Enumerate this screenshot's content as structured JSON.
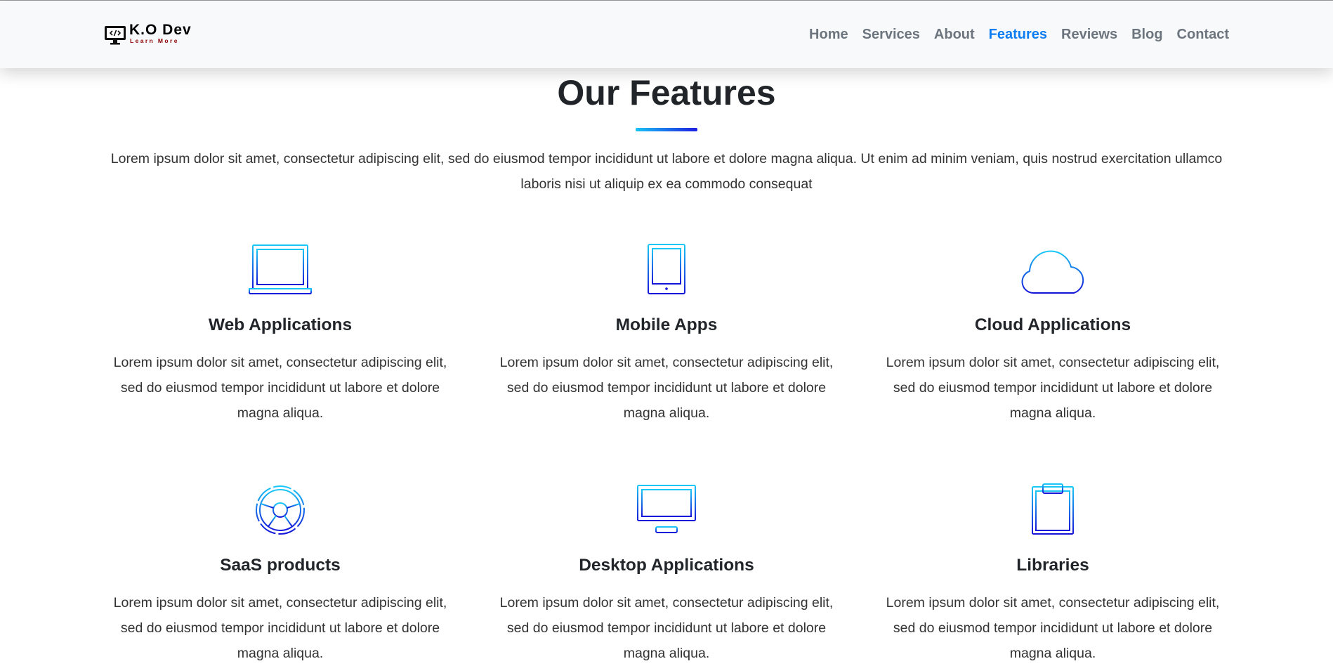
{
  "brand": {
    "name": "K.O Dev",
    "tagline": "Learn More",
    "icon": "monitor-code-icon"
  },
  "nav": {
    "items": [
      {
        "label": "Home",
        "active": false
      },
      {
        "label": "Services",
        "active": false
      },
      {
        "label": "About",
        "active": false
      },
      {
        "label": "Features",
        "active": true
      },
      {
        "label": "Reviews",
        "active": false
      },
      {
        "label": "Blog",
        "active": false
      },
      {
        "label": "Contact",
        "active": false
      }
    ],
    "active_color": "#0d7ef2",
    "inactive_color": "#6c757d"
  },
  "section": {
    "title": "Our Features",
    "intro": "Lorem ipsum dolor sit amet, consectetur adipiscing elit, sed do eiusmod tempor incididunt ut labore et dolore magna aliqua. Ut enim ad minim veniam, quis nostrud exercitation ullamco laboris nisi ut aliquip ex ea commodo consequat",
    "accent_gradient": [
      "#19c3f5",
      "#1d1de0"
    ]
  },
  "features": [
    {
      "title": "Web Applications",
      "icon": "laptop-icon",
      "text": "Lorem ipsum dolor sit amet, consectetur adipiscing elit, sed do eiusmod tempor incididunt ut labore et dolore magna aliqua."
    },
    {
      "title": "Mobile Apps",
      "icon": "tablet-icon",
      "text": "Lorem ipsum dolor sit amet, consectetur adipiscing elit, sed do eiusmod tempor incididunt ut labore et dolore magna aliqua."
    },
    {
      "title": "Cloud Applications",
      "icon": "cloud-icon",
      "text": "Lorem ipsum dolor sit amet, consectetur adipiscing elit, sed do eiusmod tempor incididunt ut labore et dolore magna aliqua."
    },
    {
      "title": "SaaS products",
      "icon": "lifebuoy-icon",
      "text": "Lorem ipsum dolor sit amet, consectetur adipiscing elit, sed do eiusmod tempor incididunt ut labore et dolore magna aliqua."
    },
    {
      "title": "Desktop Applications",
      "icon": "desktop-monitor-icon",
      "text": "Lorem ipsum dolor sit amet, consectetur adipiscing elit, sed do eiusmod tempor incididunt ut labore et dolore magna aliqua."
    },
    {
      "title": "Libraries",
      "icon": "clipboard-icon",
      "text": "Lorem ipsum dolor sit amet, consectetur adipiscing elit, sed do eiusmod tempor incididunt ut labore et dolore magna aliqua."
    }
  ]
}
